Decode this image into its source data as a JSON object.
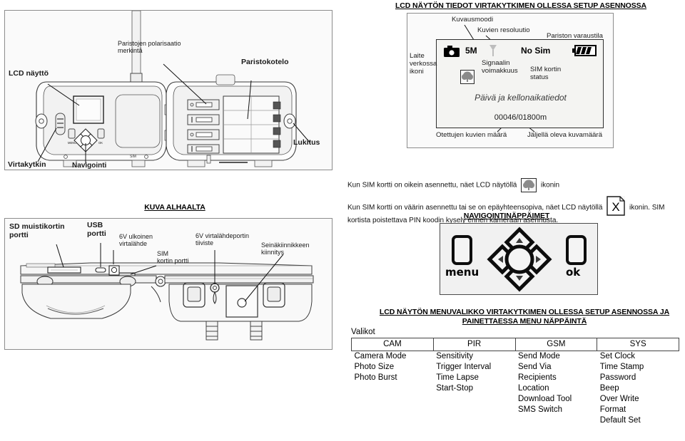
{
  "headings": {
    "lcd_info": "LCD NÄYTÖN TIEDOT VIRTAKYTKIMEN OLLESSA SETUP ASENNOSSA",
    "kuva_alhaalta": "KUVA ALHAALTA",
    "navigointinappaimet": "NAVIGOINTINÄPPÄIMET",
    "menu_line1": "LCD NÄYTÖN MENUVALIKKO VIRTAKYTKIMEN OLLESSA SETUP ASENNOSSA JA",
    "menu_line2": "PAINETTAESSA MENU NÄPPÄINTÄ"
  },
  "camera_diagram": {
    "lcd_naytto": "LCD näyttö",
    "virtakytkin": "Virtakytkin",
    "navigointi_nappaimet": "Navigointi\nnäppäimet",
    "paristojen_polarisaatio": "Paristojen polarisaatio\nmerkintä",
    "paristokotelo": "Paristokotelo",
    "lukitus": "Lukitus",
    "menu_key": "MENU",
    "ok_key": "OK",
    "sim_mark": "SIM"
  },
  "bottom_diagram": {
    "sd_portti": "SD muistikortin\nportti",
    "usb_portti": "USB\nportti",
    "ulkoinen_virtalahde": "6V ulkoinen\nvirtalähde",
    "sim_kortin_portti": "SIM\nkortin portti",
    "virtalahdeportin_tiiviste": "6V virtalähdeportin\ntiiviste",
    "seinakiinnikkeen_kiinnitys": "Seinäkiinnikkeen\nkiinnitys"
  },
  "lcd_screen": {
    "callouts": {
      "kuvausmoodi": "Kuvausmoodi",
      "kuvien_resoluutio": "Kuvien resoluutio",
      "pariston_varaustila": "Pariston varaustila",
      "laite_verkossa_ikoni": "Laite\nverkossa\nikoni",
      "signaalin_voimakkuus": "Signaalin\nvoimakkuus",
      "sim_kortin_status": "SIM kortin\nstatus",
      "otettujen_kuvien_maara": "Otettujen kuvien määrä",
      "jaljella_oleva_kuvamaara": "Jäljellä oleva kuvamäärä"
    },
    "resolution": "5M",
    "sim_status": "No Sim",
    "date_time_text": "Päivä ja kellonaikatiedot",
    "counter": "00046/01800m"
  },
  "sim_notes": {
    "note1_part1": "Kun SIM kortti on oikein asennettu, näet LCD näytöllä",
    "note1_part2": "ikonin",
    "note2_part1": "Kun SIM kortti on väärin asennettu tai se on epäyhteensopiva, näet LCD näytöllä",
    "note2_part2": "ikonin. SIM",
    "note2_line2": "kortista poistettava PIN koodin kysely ennen kameraan asennusta.",
    "x_icon_glyph": "X"
  },
  "nav_keypad": {
    "menu_label": "menu",
    "ok_label": "ok"
  },
  "menu_table": {
    "valikot_label": "Valikot",
    "headers": [
      "CAM",
      "PIR",
      "GSM",
      "SYS"
    ],
    "columns": [
      [
        "Camera Mode",
        "Photo Size",
        "Photo Burst"
      ],
      [
        "Sensitivity",
        "Trigger Interval",
        "Time Lapse",
        "Start-Stop"
      ],
      [
        "Send Mode",
        "Send Via",
        "Recipients",
        "Location",
        "Download Tool",
        "SMS Switch"
      ],
      [
        "Set Clock",
        "Time Stamp",
        "Password",
        "Beep",
        "Over Write",
        "Format",
        "Default Set"
      ]
    ]
  },
  "colors": {
    "frame_border": "#8d8d8d",
    "panel_bg": "#fafafa",
    "text": "#000000"
  }
}
